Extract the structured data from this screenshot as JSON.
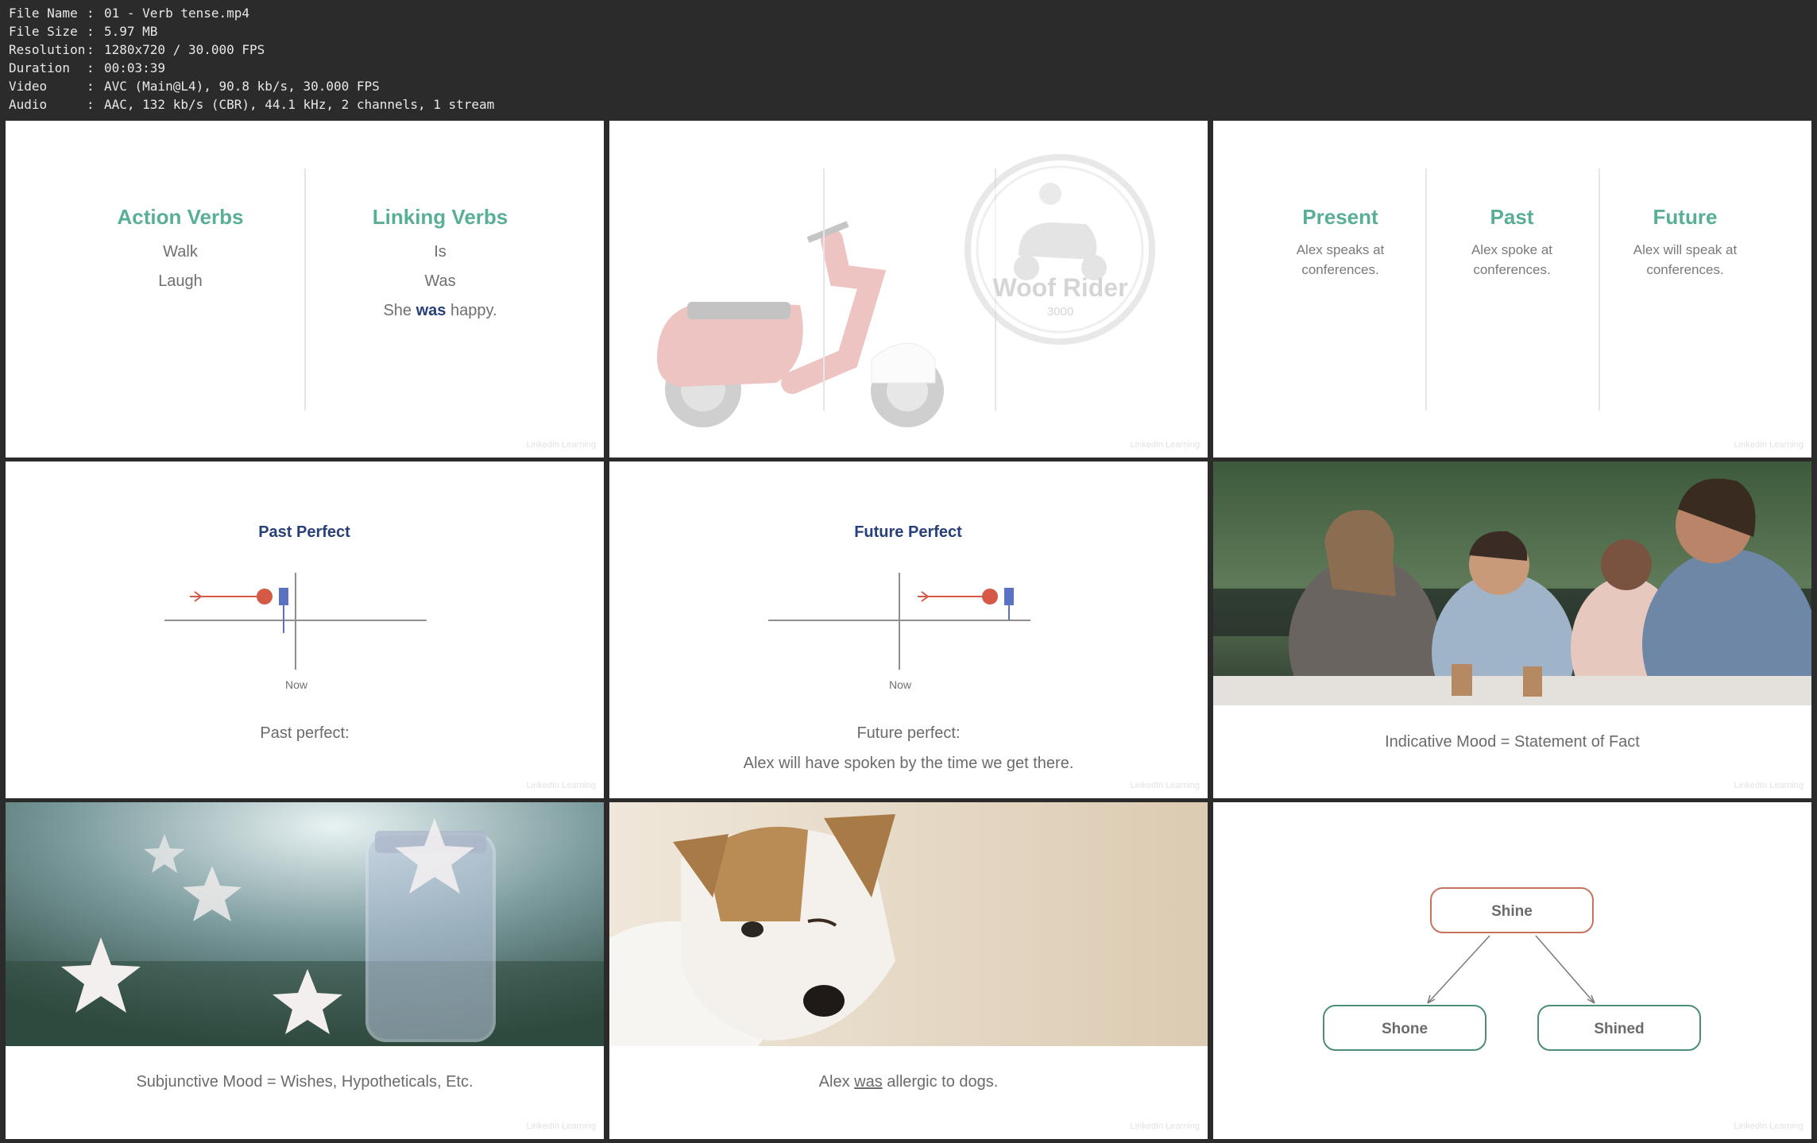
{
  "file_info": {
    "rows": [
      {
        "key": "File Name",
        "sep": ":",
        "value": "01 - Verb tense.mp4"
      },
      {
        "key": "File Size",
        "sep": ":",
        "value": "5.97 MB"
      },
      {
        "key": "Resolution",
        "sep": ":",
        "value": "1280x720 / 30.000 FPS"
      },
      {
        "key": "Duration",
        "sep": ":",
        "value": "00:03:39"
      },
      {
        "key": "Video",
        "sep": ":",
        "value": "AVC (Main@L4), 90.8 kb/s, 30.000 FPS"
      },
      {
        "key": "Audio",
        "sep": ":",
        "value": "AAC, 132 kb/s (CBR), 44.1 kHz, 2 channels, 1 stream"
      }
    ]
  },
  "watermark": "LinkedIn Learning",
  "thumbs": {
    "t1": {
      "left_heading": "Action Verbs",
      "left_items": [
        "Walk",
        "Laugh"
      ],
      "right_heading": "Linking Verbs",
      "right_items": [
        "Is",
        "Was"
      ],
      "example_pre": "She ",
      "example_bold": "was",
      "example_post": " happy."
    },
    "t2": {
      "logo_line1": "Woof Rider",
      "logo_line2": "3000"
    },
    "t3": {
      "columns": [
        {
          "heading": "Present",
          "line1": "Alex speaks at",
          "line2": "conferences."
        },
        {
          "heading": "Past",
          "line1": "Alex spoke at",
          "line2": "conferences."
        },
        {
          "heading": "Future",
          "line1": "Alex will speak at",
          "line2": "conferences."
        }
      ]
    },
    "t4": {
      "heading": "Past Perfect",
      "now_label": "Now",
      "caption": "Past perfect:"
    },
    "t5": {
      "heading": "Future Perfect",
      "now_label": "Now",
      "caption1": "Future perfect:",
      "caption2": "Alex will have spoken by the time we get there."
    },
    "t6": {
      "caption": "Indicative Mood = Statement of Fact"
    },
    "t7": {
      "caption": "Subjunctive Mood = Wishes, Hypotheticals, Etc."
    },
    "t8": {
      "caption_pre": "Alex ",
      "caption_underlined": "was",
      "caption_post": " allergic to dogs."
    },
    "t9": {
      "root": "Shine",
      "left_child": "Shone",
      "right_child": "Shined"
    }
  },
  "colors": {
    "teal": "#59ae98",
    "navy": "#27407a",
    "accent_red": "#d45a45",
    "accent_blue": "#5b72c2",
    "node_border_root": "#c5735f",
    "node_border_child": "#4c8c7c"
  }
}
